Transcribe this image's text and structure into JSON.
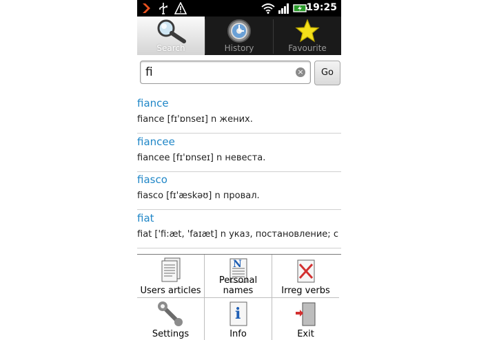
{
  "status": {
    "time": "19:25"
  },
  "tabs": [
    {
      "label": "Search"
    },
    {
      "label": "History"
    },
    {
      "label": "Favourite"
    }
  ],
  "search": {
    "value": "fi",
    "go_label": "Go"
  },
  "results": [
    {
      "word": "fiance",
      "def": "fiance [fɪ'ɒnseɪ] n жених."
    },
    {
      "word": "fiancee",
      "def": "fiancee [fɪ'ɒnseɪ] n невеста."
    },
    {
      "word": "fiasco",
      "def": "fiasco [fɪ'æskəʊ] n провал."
    },
    {
      "word": "fiat",
      "def": "fiat ['fi:æt, 'faɪæt] n указ, постановление; с..."
    }
  ],
  "menu": {
    "items": [
      {
        "label": "Users articles"
      },
      {
        "label": "Personal names"
      },
      {
        "label": "Irreg verbs"
      },
      {
        "label": "Settings"
      },
      {
        "label": "Info"
      },
      {
        "label": "Exit"
      }
    ]
  }
}
